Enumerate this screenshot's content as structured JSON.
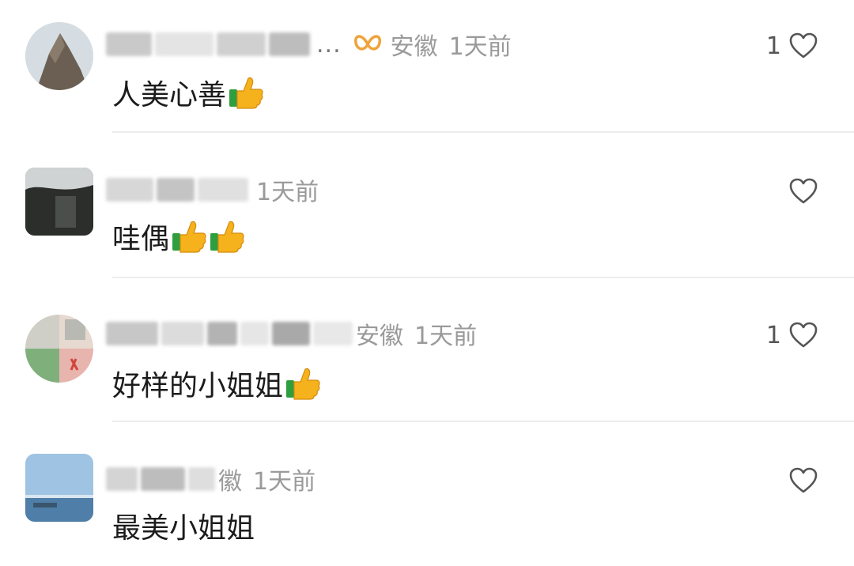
{
  "comments": [
    {
      "avatar": "rock-photo-avatar",
      "location": "安徽",
      "time": "1天前",
      "ellipsis": "...",
      "has_badge": true,
      "text": "人美心善",
      "emoji_count": 1,
      "likes": "1"
    },
    {
      "avatar": "dark-landscape-avatar",
      "location": "",
      "time": "1天前",
      "has_badge": false,
      "text": "哇偶",
      "emoji_count": 2,
      "likes": ""
    },
    {
      "avatar": "person-photo-avatar",
      "location": "安徽",
      "time": "1天前",
      "has_badge": false,
      "text": "好样的小姐姐",
      "emoji_count": 1,
      "likes": "1"
    },
    {
      "avatar": "sea-photo-avatar",
      "location": "徽",
      "time": "1天前",
      "has_badge": false,
      "text": "最美小姐姐",
      "emoji_count": 0,
      "likes": ""
    }
  ],
  "icons": {
    "like": "heart-outline-icon",
    "emoji": "thumbs-up-emoji",
    "badge": "orange-butterfly-badge-icon"
  },
  "colors": {
    "meta_text": "#9a9a9a",
    "comment_text": "#1c1c1c",
    "badge": "#f0a33a",
    "divider": "#ececec"
  }
}
